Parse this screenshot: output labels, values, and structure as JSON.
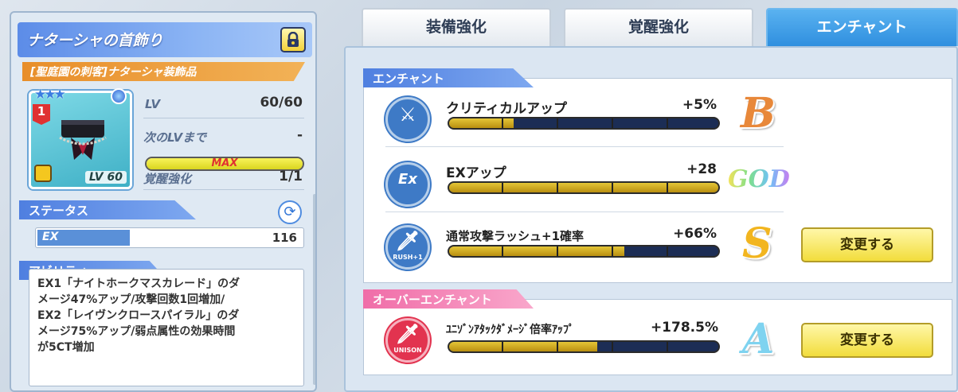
{
  "item": {
    "name": "ナターシャの首飾り",
    "subtitle": "[聖庭園の刺客]ナターシャ装飾品",
    "rank": "1",
    "stars": "★★★",
    "card_level": "LV 60"
  },
  "stats": {
    "lv_label": "LV",
    "lv_value": "60/60",
    "next_label": "次のLVまで",
    "next_value": "-",
    "max_label": "MAX",
    "exp_progress": 1.0,
    "awaken_label": "覚醒強化",
    "awaken_value": "1/1"
  },
  "status": {
    "section_label": "ステータス",
    "rows": [
      {
        "label": "EX",
        "value": "116",
        "fill": 0.35
      }
    ]
  },
  "ability": {
    "section_label": "アビリティ",
    "text_lines": [
      "EX1「ナイトホークマスカレード」のダ",
      "メージ47%アップ/攻撃回数1回増加/",
      "EX2「レイヴンクロースパイラル」のダ",
      "メージ75%アップ/弱点属性の効果時間",
      "が5CT増加"
    ]
  },
  "tabs": [
    {
      "label": "装備強化",
      "active": false
    },
    {
      "label": "覚醒強化",
      "active": false
    },
    {
      "label": "エンチャント",
      "active": true
    }
  ],
  "enchant": {
    "section_label": "エンチャント",
    "rows": [
      {
        "name": "クリティカルアップ",
        "value": "+5%",
        "grade": "B",
        "fill": 0.24,
        "icon": "sword-icon",
        "icon_caption": ""
      },
      {
        "name": "EXアップ",
        "value": "+28",
        "grade": "GOD",
        "fill": 1.0,
        "icon": "ex-icon",
        "icon_caption": ""
      },
      {
        "name": "通常攻撃ラッシュ+1確率",
        "value": "+66%",
        "grade": "S",
        "fill": 0.65,
        "icon": "rush-icon",
        "icon_caption": "RUSH+1",
        "change_label": "変更する"
      }
    ]
  },
  "over_enchant": {
    "section_label": "オーバーエンチャント",
    "rows": [
      {
        "name": "ﾕﾆｿﾞﾝｱﾀｯｸﾀﾞﾒｰｼﾞ倍率ｱｯﾌﾟ",
        "value": "+178.5%",
        "grade": "A",
        "fill": 0.55,
        "icon": "unison-icon",
        "icon_caption": "UNISON",
        "change_label": "変更する"
      }
    ]
  },
  "colors": {
    "accent_blue": "#2f8fdf",
    "bar_gold": "#d4b022",
    "bar_navy": "#1c2d55",
    "grade_B": "#e8883a",
    "grade_S": "#f2b51f",
    "grade_A": "#7fd3f0",
    "button_yellow": "#f2dd3c"
  }
}
